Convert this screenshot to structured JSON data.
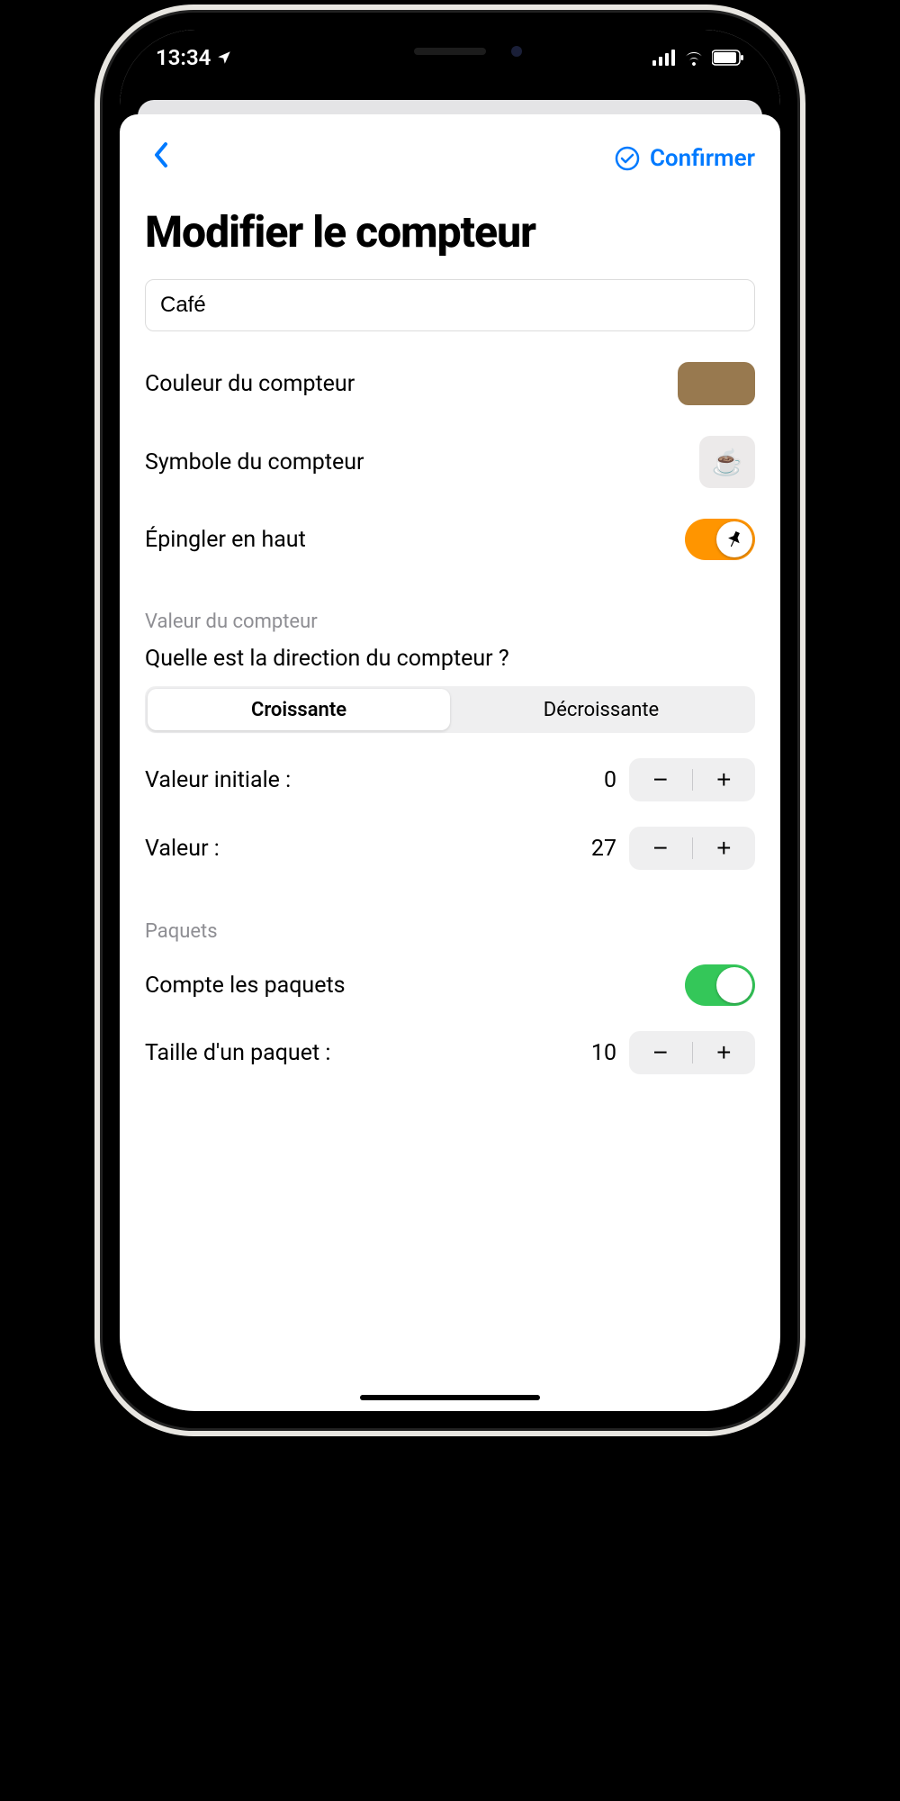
{
  "status": {
    "time": "13:34"
  },
  "nav": {
    "confirm_label": "Confirmer"
  },
  "title": "Modifier le compteur",
  "name_input": {
    "value": "Café"
  },
  "rows": {
    "color_label": "Couleur du compteur",
    "color_value": "#98794f",
    "symbol_label": "Symbole du compteur",
    "symbol_glyph": "☕",
    "pin_label": "Épingler en haut",
    "pin_on": true
  },
  "value_section": {
    "header": "Valeur du compteur",
    "question": "Quelle est la direction du compteur ?",
    "segment_asc": "Croissante",
    "segment_desc": "Décroissante",
    "selected": "asc",
    "initial_label": "Valeur initiale :",
    "initial_value": "0",
    "current_label": "Valeur :",
    "current_value": "27"
  },
  "packets_section": {
    "header": "Paquets",
    "count_label": "Compte les paquets",
    "count_on": true,
    "size_label": "Taille d'un paquet :",
    "size_value": "10"
  }
}
